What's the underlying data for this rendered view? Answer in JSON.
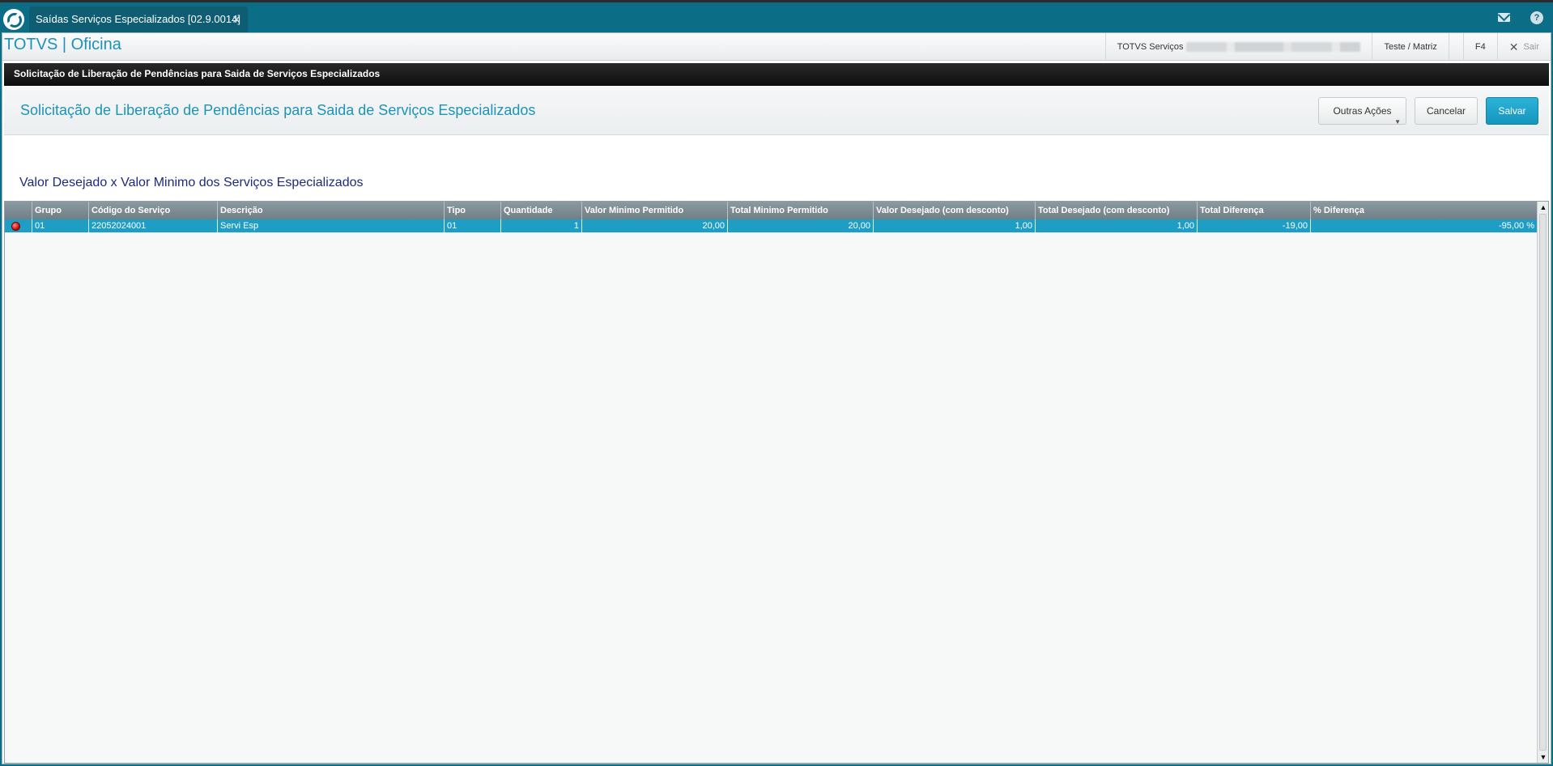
{
  "tab": {
    "title": "Saídas Serviços Especializados [02.9.0014]",
    "close": "✕"
  },
  "topbar": {
    "mail_icon": "mail-icon",
    "help_glyph": "?"
  },
  "app": {
    "title": "TOTVS | Oficina",
    "company_label": "TOTVS Serviços",
    "branch": "Teste / Matriz",
    "f4": "F4",
    "exit_glyph": "✕",
    "exit": "Sair"
  },
  "darkbar": {
    "title": "Solicitação de Liberação de Pendências para Saida de Serviços Especializados"
  },
  "header": {
    "title": "Solicitação de Liberação de Pendências para Saida de Serviços Especializados",
    "outras_acoes": "Outras Ações",
    "caret": "▼",
    "cancelar": "Cancelar",
    "salvar": "Salvar"
  },
  "section": {
    "title": "Valor Desejado x Valor Minimo dos Serviços Especializados"
  },
  "grid": {
    "columns": [
      "",
      "Grupo",
      "Código do Serviço",
      "Descrição",
      "Tipo",
      "Quantidade",
      "Valor Minimo Permitido",
      "Total Minimo Permitido",
      "Valor Desejado (com desconto)",
      "Total Desejado (com desconto)",
      "Total Diferença",
      "% Diferença"
    ],
    "rows": [
      [
        "",
        "01",
        "22052024001",
        "Servi Esp",
        "01",
        "1",
        "20,00",
        "20,00",
        "1,00",
        "1,00",
        "-19,00",
        "-95,00 %"
      ]
    ],
    "row_status_color": "#c40000",
    "scroll_up": "▲",
    "scroll_down": "▼"
  },
  "colors": {
    "accent": "#1d93b8",
    "topbar": "#0b6d86",
    "selected_row": "#1e9ec5"
  }
}
